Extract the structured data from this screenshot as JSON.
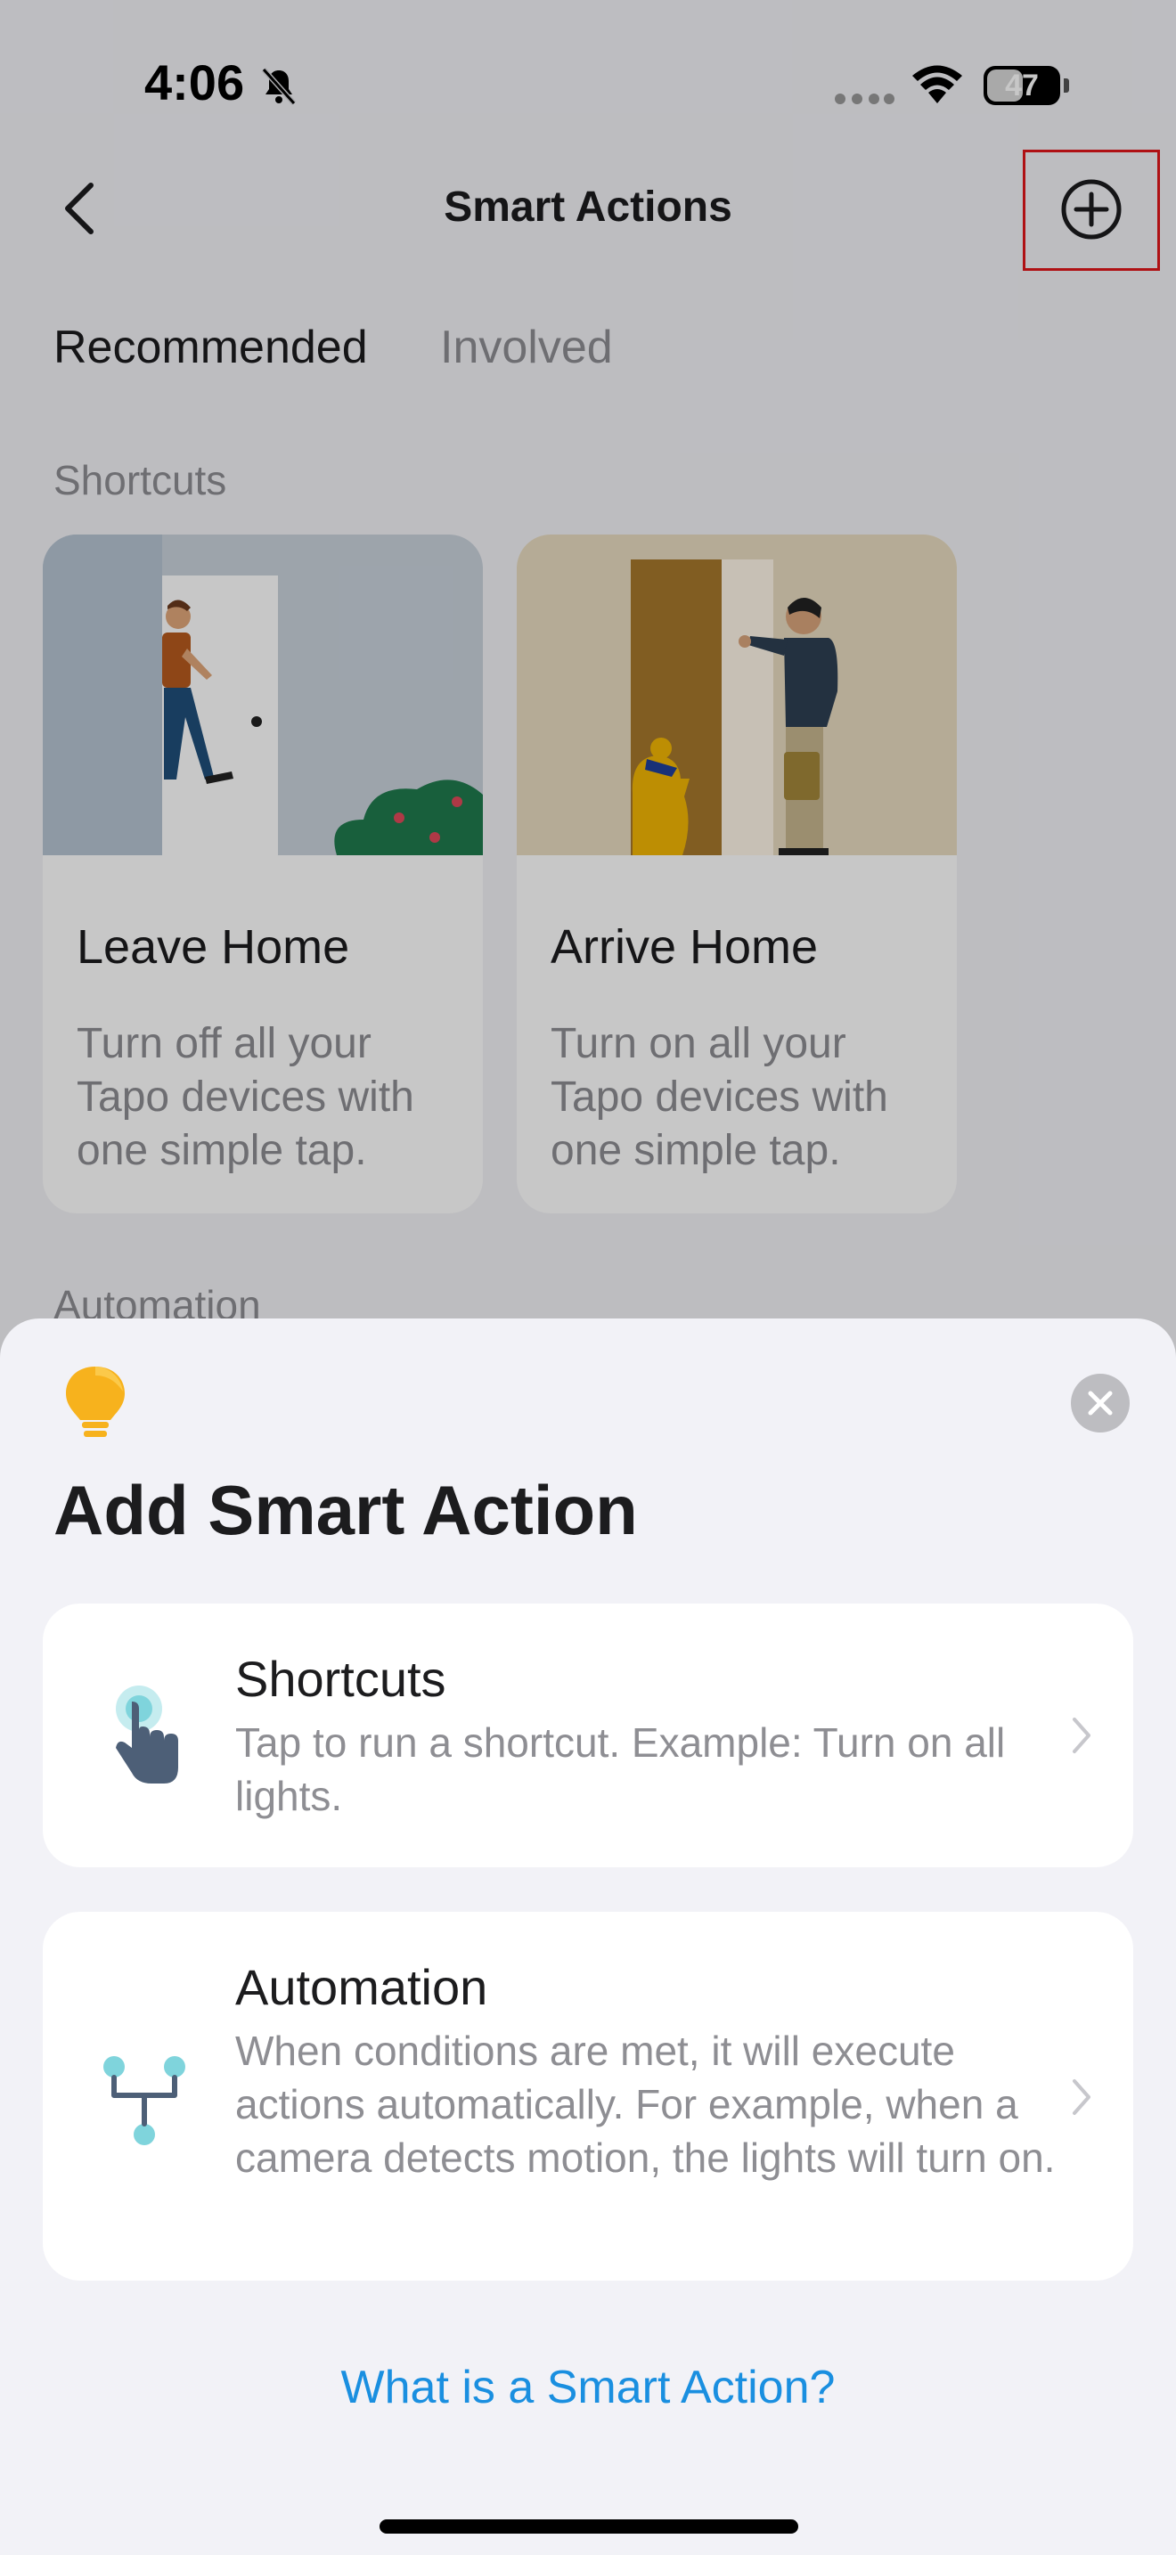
{
  "status_bar": {
    "time": "4:06",
    "battery": "47"
  },
  "nav": {
    "title": "Smart Actions"
  },
  "tabs": [
    {
      "label": "Recommended",
      "active": true
    },
    {
      "label": "Involved",
      "active": false
    }
  ],
  "sections": {
    "shortcuts": "Shortcuts",
    "automation": "Automation"
  },
  "cards": [
    {
      "title": "Leave Home",
      "description": "Turn off all your Tapo devices with one simple tap."
    },
    {
      "title": "Arrive Home",
      "description": "Turn on all your Tapo devices with one simple tap."
    }
  ],
  "sheet": {
    "title": "Add Smart Action",
    "options": [
      {
        "title": "Shortcuts",
        "description": "Tap to run a shortcut. Example: Turn on all lights.",
        "icon": "tap-hand-icon"
      },
      {
        "title": "Automation",
        "description": "When conditions are met, it will execute actions automatically. For example, when a camera detects motion, the lights will turn on.",
        "icon": "flow-branch-icon"
      }
    ],
    "help_link": "What is a Smart Action?"
  },
  "colors": {
    "accent": "#1a8fe0",
    "highlight": "#e0171a",
    "bulb": "#f7b21d",
    "icon_teal": "#7fd4dc"
  }
}
